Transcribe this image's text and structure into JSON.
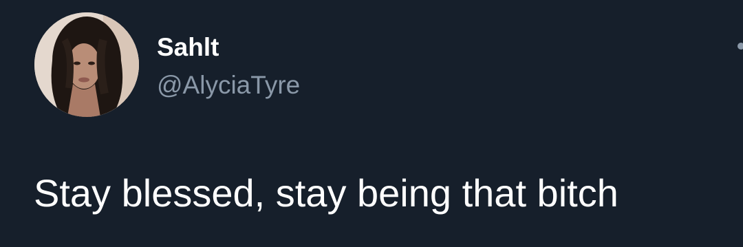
{
  "tweet": {
    "author": {
      "display_name": "Sahlt",
      "handle": "@AlyciaTyre",
      "avatar_icon": "profile-photo"
    },
    "text": "Stay blessed, stay being that bitch",
    "more_icon": "more-options-icon"
  },
  "colors": {
    "background": "#161f2b",
    "primary_text": "#ffffff",
    "secondary_text": "#8a98a8"
  }
}
